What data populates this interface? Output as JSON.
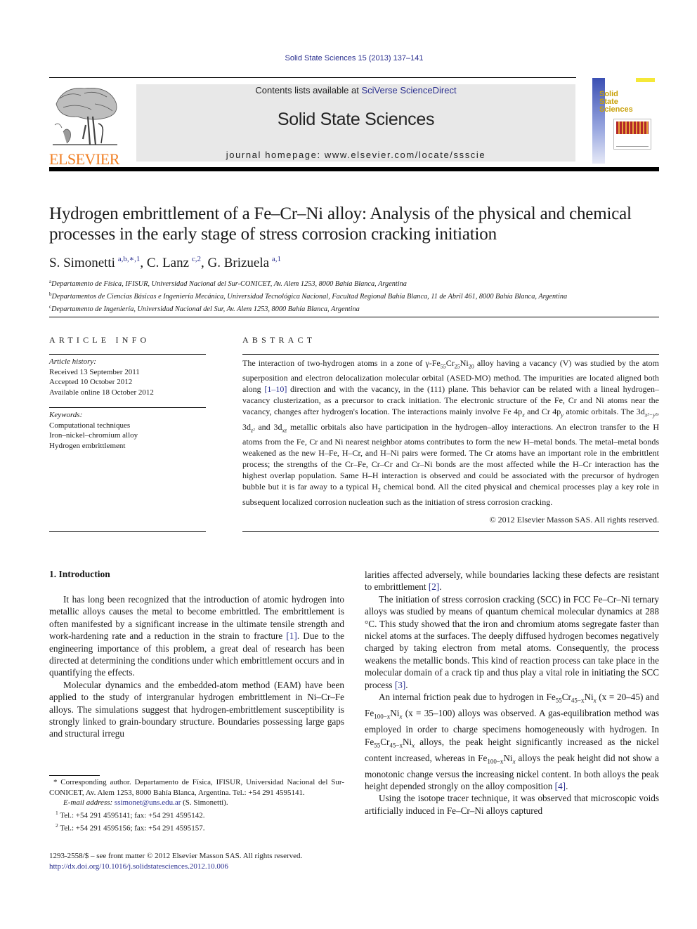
{
  "header": {
    "citation": "Solid State Sciences 15 (2013) 137–141",
    "contents_prefix": "Contents lists available at ",
    "contents_link": "SciVerse ScienceDirect",
    "journal_title": "Solid State Sciences",
    "homepage_prefix": "journal homepage: ",
    "homepage_url": "www.elsevier.com/locate/ssscie",
    "publisher_logo_text": "ELSEVIER",
    "cover_title_lines": [
      "Solid",
      "State",
      "Sciences"
    ],
    "colors": {
      "link": "#2a2f8f",
      "elsevier_orange": "#f07e22",
      "header_box": "#e8e8e8"
    }
  },
  "article": {
    "title": "Hydrogen embrittlement of a Fe–Cr–Ni alloy: Analysis of the physical and chemical processes in the early stage of stress corrosion cracking initiation",
    "authors": [
      {
        "name": "S. Simonetti",
        "marks": "a,b,∗,1",
        "separator": ", "
      },
      {
        "name": "C. Lanz",
        "marks": "c,2",
        "separator": ", "
      },
      {
        "name": "G. Brizuela",
        "marks": "a,1",
        "separator": ""
      }
    ],
    "affiliations": [
      {
        "mark": "a",
        "text": "Departamento de Física, IFISUR, Universidad Nacional del Sur-CONICET, Av. Alem 1253, 8000 Bahía Blanca, Argentina"
      },
      {
        "mark": "b",
        "text": "Departamentos de Ciencias Básicas e Ingeniería Mecánica, Universidad Tecnológica Nacional, Facultad Regional Bahía Blanca, 11 de Abril 461, 8000 Bahía Blanca, Argentina"
      },
      {
        "mark": "c",
        "text": "Departamento de Ingeniería, Universidad Nacional del Sur, Av. Alem 1253, 8000 Bahía Blanca, Argentina"
      }
    ]
  },
  "article_info": {
    "heading": "ARTICLE INFO",
    "history_label": "Article history:",
    "history": [
      "Received 13 September 2011",
      "Accepted 10 October 2012",
      "Available online 18 October 2012"
    ],
    "keywords_label": "Keywords:",
    "keywords": [
      "Computational techniques",
      "Iron–nickel–chromium alloy",
      "Hydrogen embrittlement"
    ]
  },
  "abstract": {
    "heading": "ABSTRACT",
    "parts": {
      "p1": "The interaction of two-hydrogen atoms in a zone of γ-Fe",
      "s1": "55",
      "p2": "Cr",
      "s2": "25",
      "p3": "Ni",
      "s3": "20",
      "p4": " alloy having a vacancy (V) was studied by the atom superposition and electron delocalization molecular orbital (ASED-MO) method. The impurities are located aligned both along ",
      "ref1": "[1–10]",
      "p5": " direction and with the vacancy, in the (111) plane. This behavior can be related with a lineal hydrogen–vacancy clusterization, as a precursor to crack initiation. The electronic structure of the Fe, Cr and Ni atoms near the vacancy, changes after hydrogen's location. The interactions mainly involve Fe 4p",
      "s4": "x",
      "p6": " and Cr 4p",
      "s5": "y",
      "p7": " atomic orbitals. The 3d",
      "s6": "x²−y²",
      "p8": ", 3d",
      "s7": "z²",
      "p9": " and 3d",
      "s8": "xz",
      "p10": " metallic orbitals also have participation in the hydrogen–alloy interactions. An electron transfer to the H atoms from the Fe, Cr and Ni nearest neighbor atoms contributes to form the new H–metal bonds. The metal–metal bonds weakened as the new H–Fe, H–Cr, and H–Ni pairs were formed. The Cr atoms have an important role in the embrittlent process; the strengths of the Cr–Fe, Cr–Cr and Cr–Ni bonds are the most affected while the H–Cr interaction has the highest overlap population. Same H–H interaction is observed and could be associated with the precursor of hydrogen bubble but it is far away to a typical H",
      "s9": "2",
      "p11": " chemical bond. All the cited physical and chemical processes play a key role in subsequent localized corrosion nucleation such as the initiation of stress corrosion cracking."
    },
    "copyright": "© 2012 Elsevier Masson SAS. All rights reserved."
  },
  "body": {
    "section_heading": "1.  Introduction",
    "left": {
      "p1a": "It has long been recognized that the introduction of atomic hydrogen into metallic alloys causes the metal to become embrittled. The embrittlement is often manifested by a significant increase in the ultimate tensile strength and work-hardening rate and a reduction in the strain to fracture ",
      "p1ref": "[1]",
      "p1b": ". Due to the engineering importance of this problem, a great deal of research has been directed at determining the conditions under which embrittlement occurs and in quantifying the effects.",
      "p2": "Molecular dynamics and the embedded-atom method (EAM) have been applied to the study of intergranular hydrogen embrittlement in Ni–Cr–Fe alloys. The simulations suggest that hydrogen-embrittlement susceptibility is strongly linked to grain-boundary structure. Boundaries possessing large gaps and structural irregu"
    },
    "right": {
      "p0a": "larities affected adversely, while boundaries lacking these defects are resistant to embrittlement ",
      "p0ref": "[2]",
      "p0b": ".",
      "p1a": "The initiation of stress corrosion cracking (SCC) in FCC Fe–Cr–Ni ternary alloys was studied by means of quantum chemical molecular dynamics at 288 °C. This study showed that the iron and chromium atoms segregate faster than nickel atoms at the surfaces. The deeply diffused hydrogen becomes negatively charged by taking electron from metal atoms. Consequently, the process weakens the metallic bonds. This kind of reaction process can take place in the molecular domain of a crack tip and thus play a vital role in initiating the SCC process ",
      "p1ref": "[3]",
      "p1b": ".",
      "p2": {
        "t1": "An internal friction peak due to hydrogen in Fe",
        "s1": "55",
        "t2": "Cr",
        "s2": "45−x",
        "t3": "Ni",
        "s3": "x",
        "t4": " (x = 20–45) and Fe",
        "s4": "100−x",
        "t5": "Ni",
        "s5": "x",
        "t6": " (x = 35–100) alloys was observed. A gas-equilibration method was employed in order to charge specimens homogeneously with hydrogen. In Fe",
        "s6": "55",
        "t7": "Cr",
        "s7": "45−x",
        "t8": "Ni",
        "s8": "x",
        "t9": " alloys, the peak height significantly increased as the nickel content increased, whereas in Fe",
        "s9": "100−x",
        "t10": "Ni",
        "s10": "x",
        "t11": " alloys the peak height did not show a monotonic change versus the increasing nickel content. In both alloys the peak height depended strongly on the alloy composition ",
        "ref": "[4]",
        "t12": "."
      },
      "p3": "Using the isotope tracer technique, it was observed that microscopic voids artificially induced in Fe–Cr–Ni alloys captured"
    }
  },
  "footnotes": {
    "corresponding": "* Corresponding author. Departamento de Física, IFISUR, Universidad Nacional del Sur-CONICET, Av. Alem 1253, 8000 Bahía Blanca, Argentina. Tel.: +54 291 4595141.",
    "email_label": "E-mail address: ",
    "email": "ssimonet@uns.edu.ar",
    "email_suffix": " (S. Simonetti).",
    "fn1_mark": "1",
    "fn1": " Tel.: +54 291 4595141; fax: +54 291 4595142.",
    "fn2_mark": "2",
    "fn2": " Tel.: +54 291 4595156; fax: +54 291 4595157.",
    "issn": "1293-2558/$ – see front matter © 2012 Elsevier Masson SAS. All rights reserved.",
    "doi": "http://dx.doi.org/10.1016/j.solidstatesciences.2012.10.006"
  }
}
